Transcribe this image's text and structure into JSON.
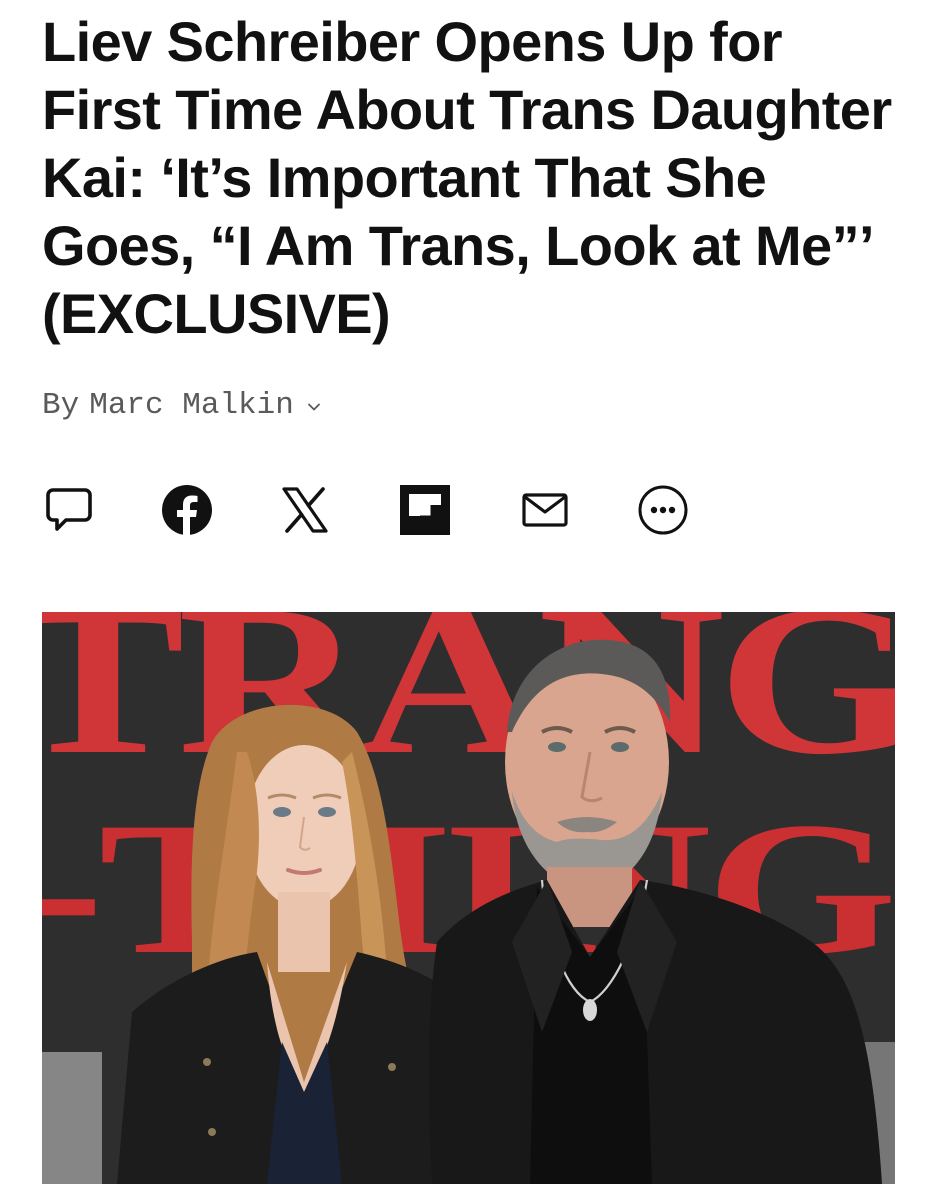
{
  "article": {
    "headline": "Liev Schreiber Opens Up for First Time About Trans Daughter Kai: ‘It’s Important That She Goes, “I Am Trans, Look at Me”’ (EXCLUSIVE)",
    "byline": {
      "prefix": "By",
      "author": "Marc Malkin",
      "icon": "chevron-down-icon"
    }
  },
  "share_bar": {
    "buttons": [
      {
        "id": "comment",
        "icon": "comment-icon"
      },
      {
        "id": "facebook",
        "icon": "facebook-icon"
      },
      {
        "id": "x",
        "icon": "x-icon"
      },
      {
        "id": "flipboard",
        "icon": "flipboard-icon"
      },
      {
        "id": "email",
        "icon": "email-icon"
      },
      {
        "id": "more",
        "icon": "more-icon"
      }
    ]
  },
  "hero_image": {
    "backdrop_text_top": "TRANG",
    "backdrop_text_bottom": "-THING",
    "accent_color": "#e5353a",
    "backdrop_color": "#2e2e30"
  }
}
